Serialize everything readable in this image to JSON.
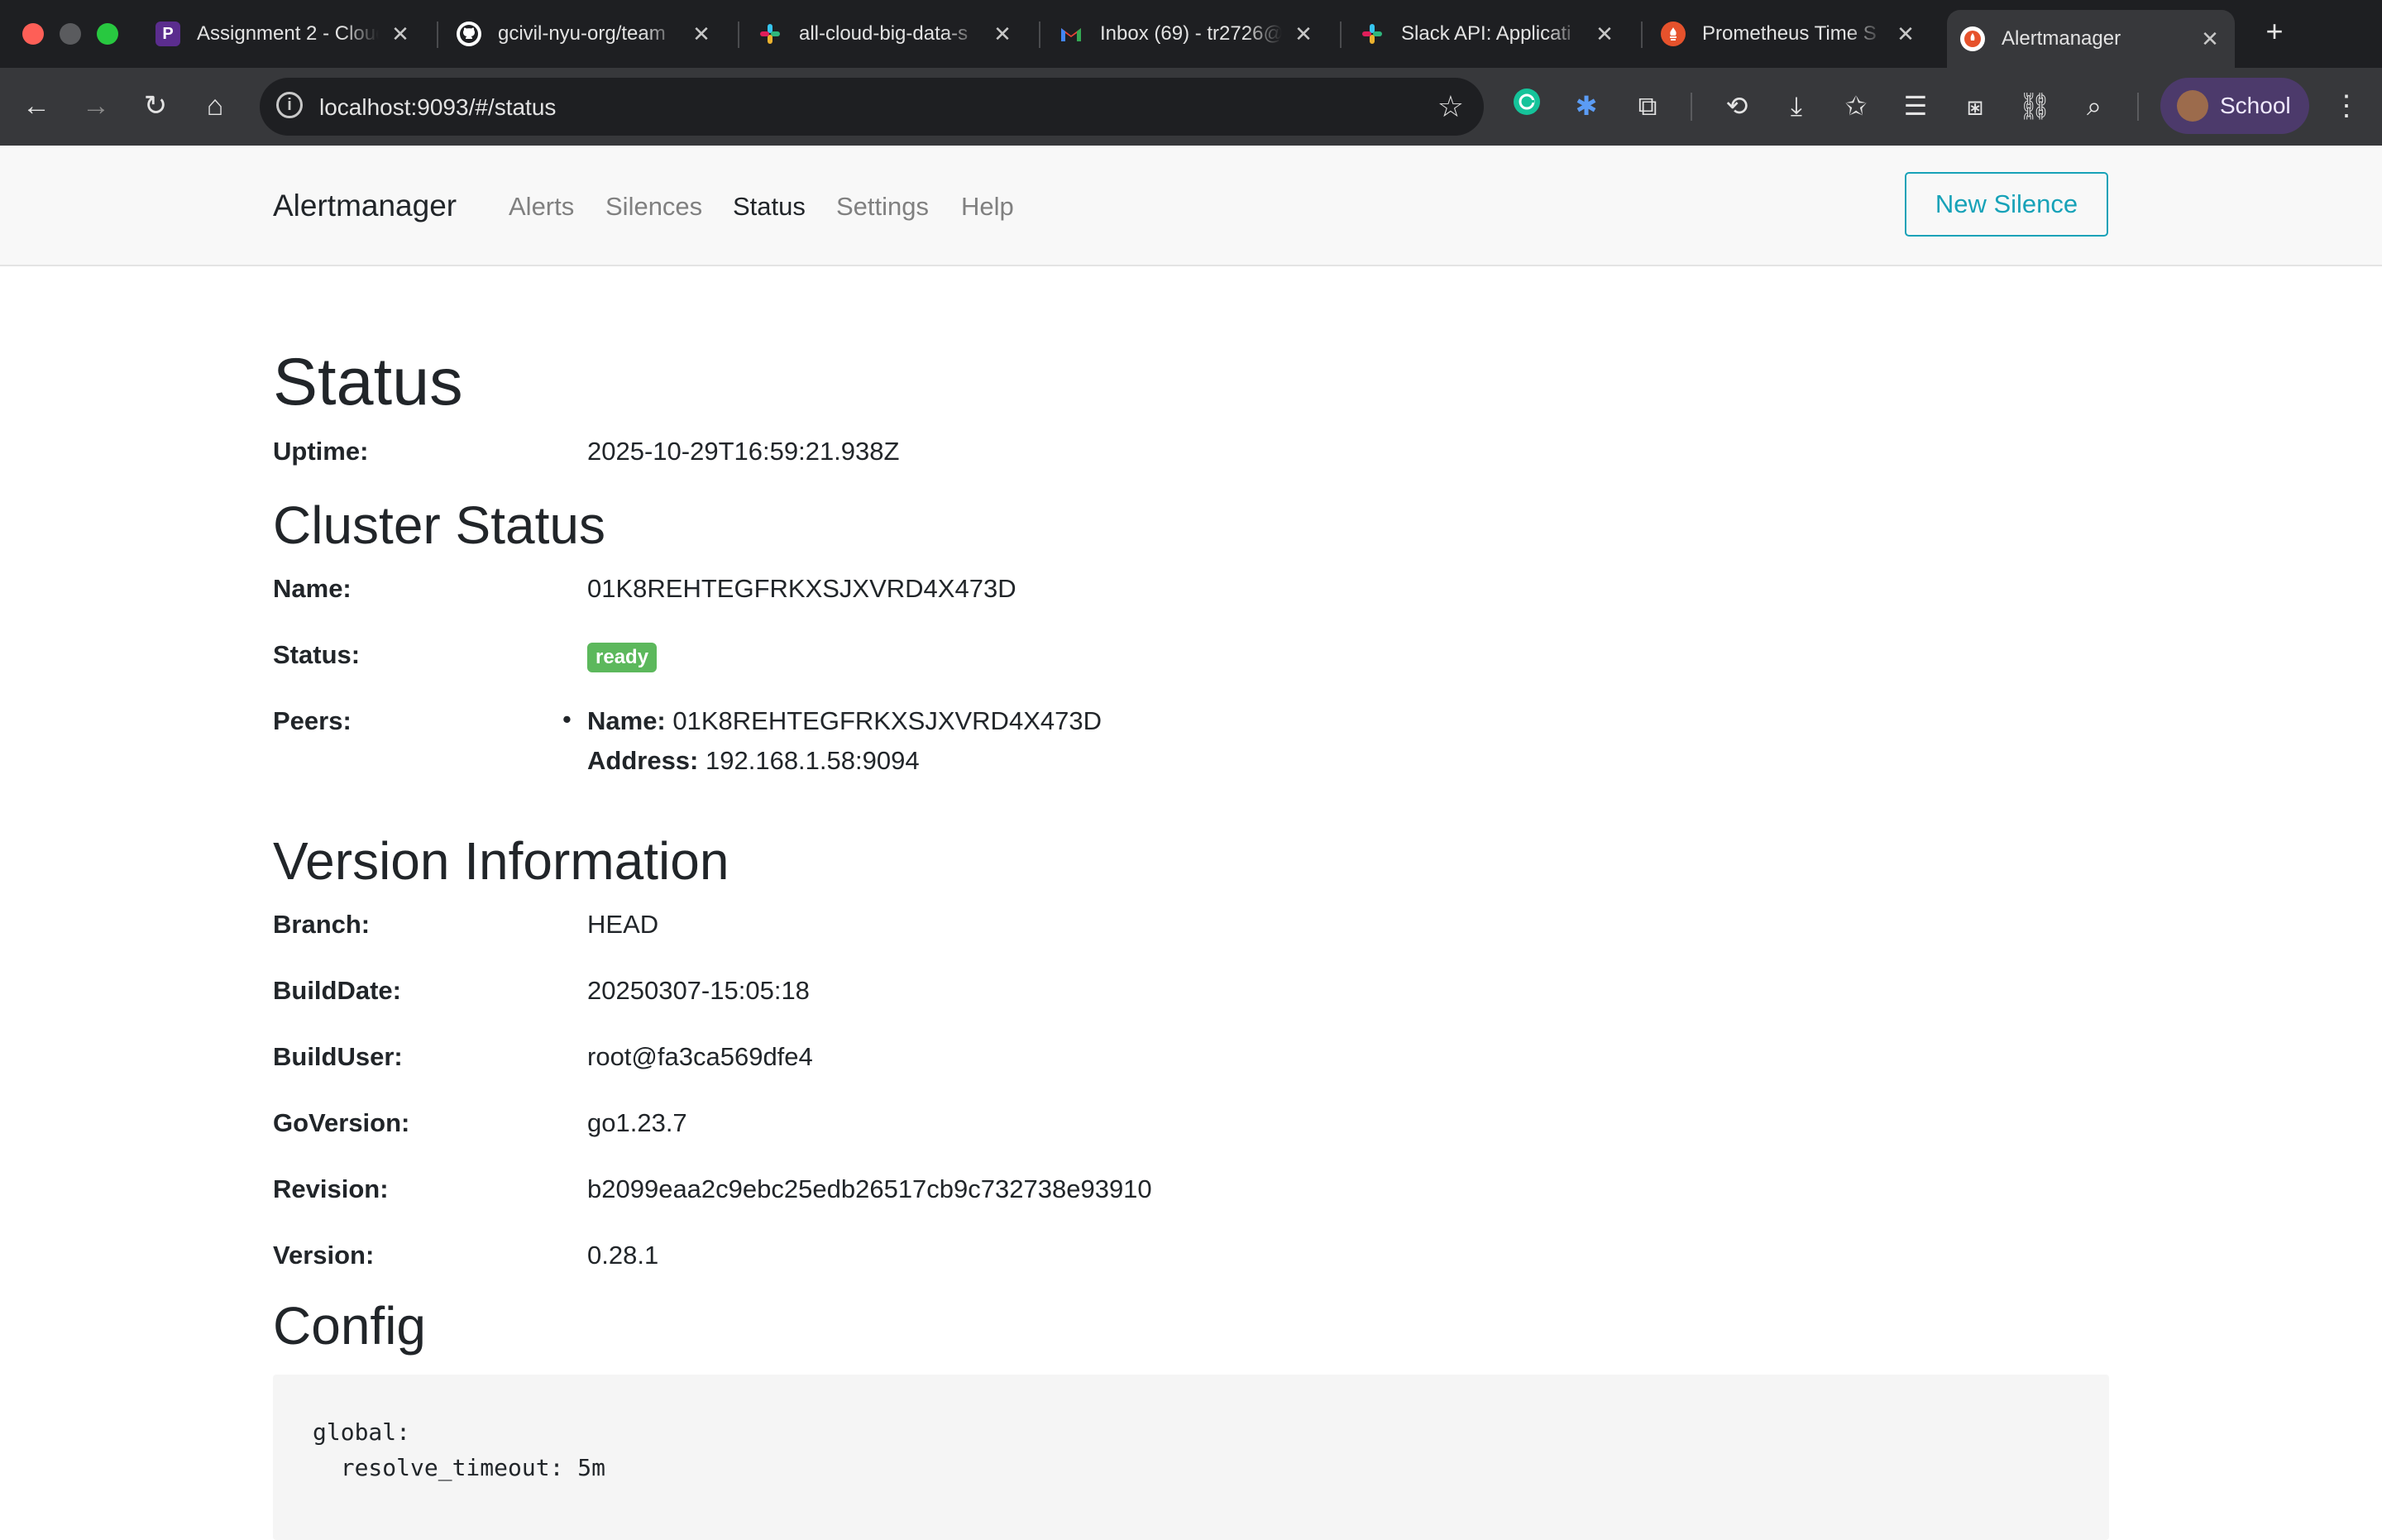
{
  "browser": {
    "tabs": [
      {
        "label": "Assignment 2 - Cloud",
        "favicon": "P"
      },
      {
        "label": "gcivil-nyu-org/team",
        "favicon": "github-icon"
      },
      {
        "label": "all-cloud-big-data-s",
        "favicon": "slack-icon"
      },
      {
        "label": "Inbox (69) - tr2726@",
        "favicon": "gmail-icon"
      },
      {
        "label": "Slack API: Applicati",
        "favicon": "slack-icon"
      },
      {
        "label": "Prometheus Time S",
        "favicon": "prometheus-icon"
      },
      {
        "label": "Alertmanager",
        "favicon": "alertmanager-icon",
        "active": true
      }
    ],
    "url": "localhost:9093/#/status",
    "profile_label": "School"
  },
  "nav": {
    "brand": "Alertmanager",
    "links": [
      "Alerts",
      "Silences",
      "Status",
      "Settings",
      "Help"
    ],
    "active": "Status",
    "new_silence_label": "New Silence"
  },
  "status": {
    "title": "Status",
    "uptime_label": "Uptime:",
    "uptime": "2025-10-29T16:59:21.938Z"
  },
  "cluster": {
    "title": "Cluster Status",
    "name_label": "Name:",
    "name": "01K8REHTEGFRKXSJXVRD4X473D",
    "status_label": "Status:",
    "status": "ready",
    "peers_label": "Peers:",
    "peer_name_label": "Name:",
    "peer_name": "01K8REHTEGFRKXSJXVRD4X473D",
    "peer_address_label": "Address:",
    "peer_address": "192.168.1.58:9094"
  },
  "version": {
    "title": "Version Information",
    "rows": [
      {
        "label": "Branch:",
        "value": "HEAD"
      },
      {
        "label": "BuildDate:",
        "value": "20250307-15:05:18"
      },
      {
        "label": "BuildUser:",
        "value": "root@fa3ca569dfe4"
      },
      {
        "label": "GoVersion:",
        "value": "go1.23.7"
      },
      {
        "label": "Revision:",
        "value": "b2099eaa2c9ebc25edb26517cb9c732738e93910"
      },
      {
        "label": "Version:",
        "value": "0.28.1"
      }
    ]
  },
  "config": {
    "title": "Config",
    "text": "global:\n  resolve_timeout: 5m"
  },
  "colors": {
    "accent": "#17a2b8",
    "badge_ready": "#5cb85c",
    "chrome_dark": "#1e1f22",
    "chrome_toolbar": "#37383b"
  }
}
